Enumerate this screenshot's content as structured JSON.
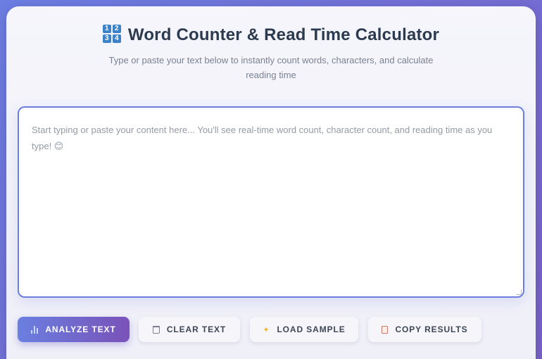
{
  "header": {
    "title": "Word Counter & Read Time Calculator",
    "subtitle": "Type or paste your text below to instantly count words, characters, and calculate reading time",
    "icon": "numbers-keycap-icon"
  },
  "editor": {
    "value": "",
    "placeholder": "Start typing or paste your content here... You'll see real-time word count, character count, and reading time as you type! 😊"
  },
  "buttons": {
    "analyze": "ANALYZE TEXT",
    "clear": "CLEAR TEXT",
    "sample": "LOAD SAMPLE",
    "copy": "COPY RESULTS"
  },
  "colors": {
    "accent": "#6c7fe0",
    "accent_end": "#7a52b8",
    "title": "#2c3a4f"
  }
}
